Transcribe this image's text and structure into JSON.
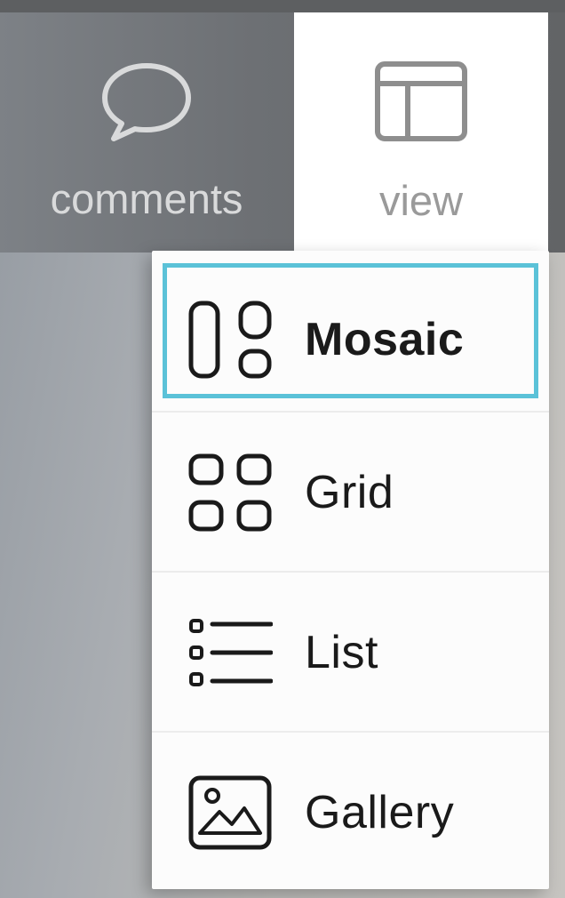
{
  "toolbar": {
    "comments": {
      "label": "comments",
      "icon": "speech-bubble-icon"
    },
    "view": {
      "label": "view",
      "icon": "layout-icon",
      "active": true
    }
  },
  "view_menu": {
    "items": [
      {
        "label": "Mosaic",
        "icon": "mosaic-icon",
        "selected": true
      },
      {
        "label": "Grid",
        "icon": "grid-icon",
        "selected": false
      },
      {
        "label": "List",
        "icon": "list-icon",
        "selected": false
      },
      {
        "label": "Gallery",
        "icon": "image-icon",
        "selected": false
      }
    ]
  },
  "colors": {
    "focus_ring": "#5bc2d8",
    "toolbar_bg": "#6d7074",
    "active_tab_bg": "#ffffff",
    "menu_text": "#1a1a1a"
  }
}
